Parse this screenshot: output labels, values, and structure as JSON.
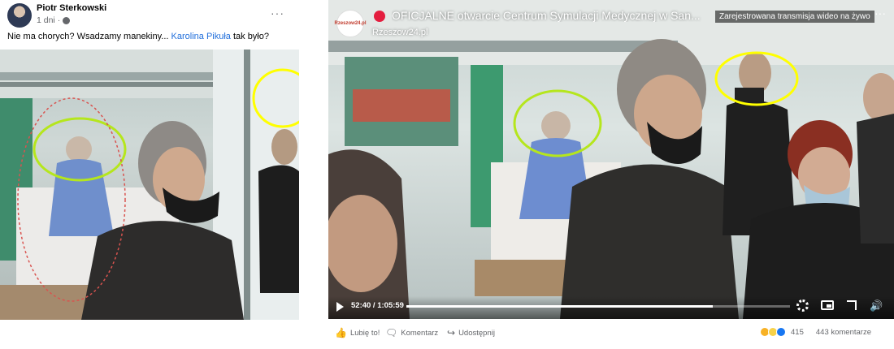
{
  "left_post": {
    "author": "Piotr Sterkowski",
    "time": "1 dni",
    "separator": "·",
    "text_before": "Nie ma chorych? Wsadzamy manekiny... ",
    "tagged_name": "Karolina Pikuła",
    "text_after": " tak było?",
    "more_label": "···"
  },
  "video": {
    "channel_logo_text": "Rzeszow24.pl",
    "title": "OFICJALNE otwarcie Centrum Symulacji Medycznej w San...",
    "channel": "Rzeszow24.pl",
    "badge": "Zarejestrowana transmisja wideo na żywo",
    "more_label": "···",
    "time": "52:40 / 1:05:59",
    "progress": 0.798,
    "volume_glyph": "🔊"
  },
  "actions": {
    "like": "Lubię to!",
    "comment": "Komentarz",
    "share": "Udostępnij",
    "like_glyph": "👍",
    "comment_glyph": "🗨",
    "share_glyph": "↪"
  },
  "stats": {
    "reactions_count": "415",
    "comments_count": "443 komentarze"
  },
  "colors": {
    "link": "#216fdb",
    "live_red": "#e41e3f",
    "highlight_yellow": "#ffff00",
    "highlight_green": "#b5e61d",
    "highlight_red": "#d9534f"
  }
}
